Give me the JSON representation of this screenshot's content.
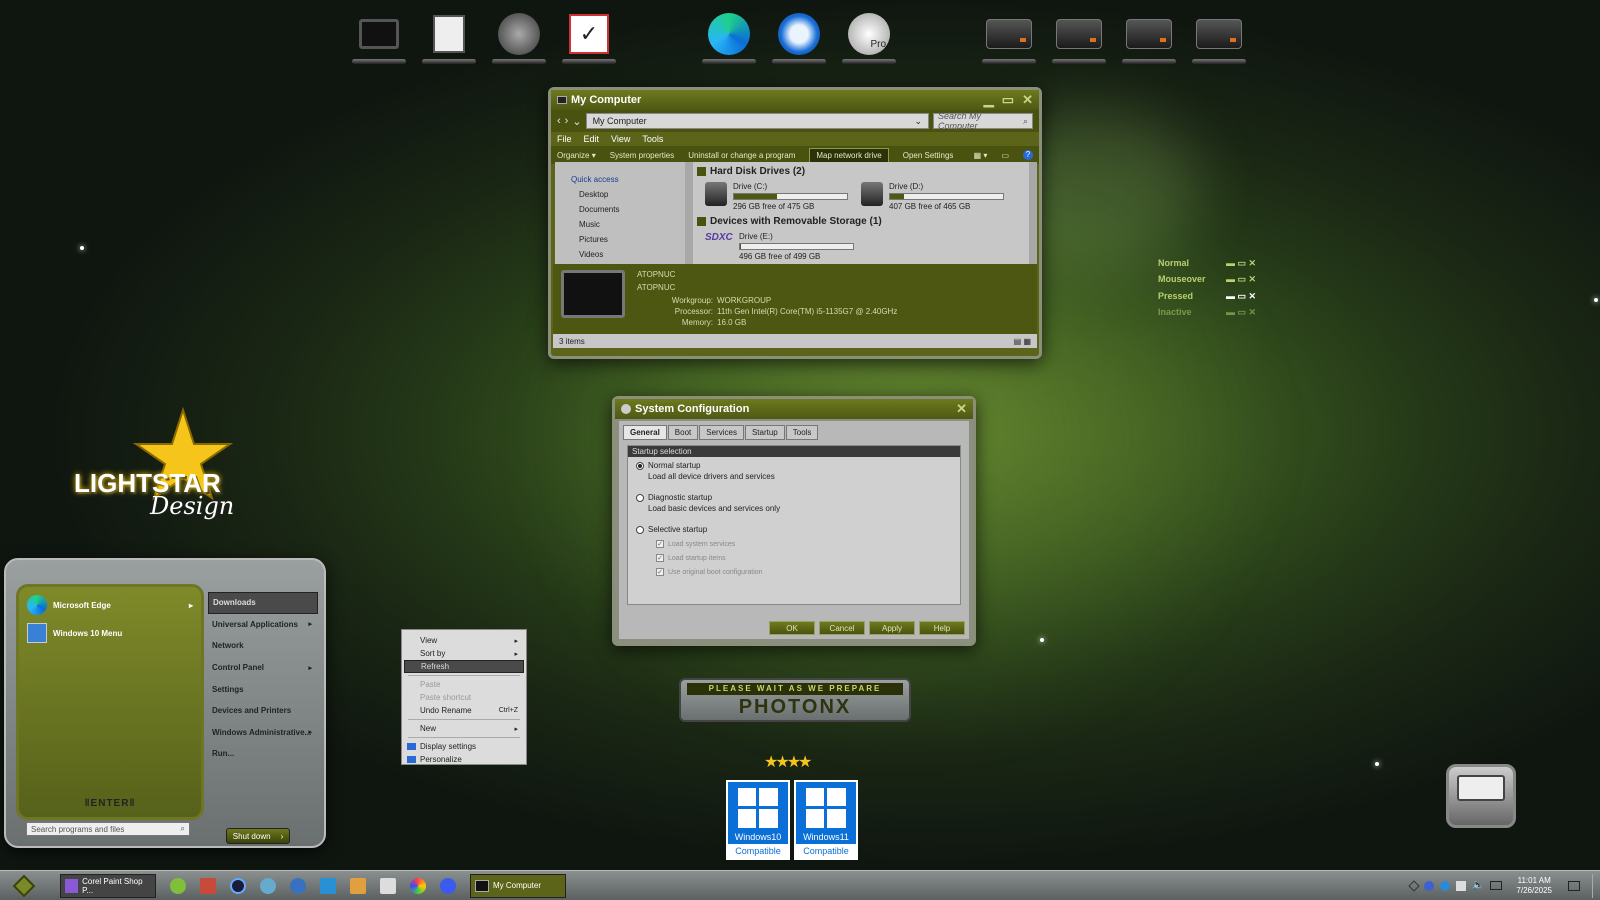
{
  "dock": {
    "left": [
      {
        "icon": "computer-icon"
      },
      {
        "icon": "documents-icon"
      },
      {
        "icon": "network-dish-icon"
      },
      {
        "icon": "checklist-icon"
      }
    ],
    "center": [
      {
        "icon": "edge-icon"
      },
      {
        "icon": "thunderbird-icon"
      },
      {
        "icon": "pro-icon",
        "label": "Pro"
      }
    ],
    "right": [
      {
        "icon": "drive-dvd-icon"
      },
      {
        "icon": "drive-icon"
      },
      {
        "icon": "drive-icon"
      },
      {
        "icon": "drive-icon"
      }
    ]
  },
  "mycomputer": {
    "title": "My Computer",
    "address": "My Computer",
    "search_placeholder": "Search My Computer",
    "menu": [
      "File",
      "Edit",
      "View",
      "Tools"
    ],
    "commands": [
      "Organize",
      "System properties",
      "Uninstall or change a program",
      "Map network drive",
      "Open Settings"
    ],
    "nav": [
      "Quick access",
      "Desktop",
      "Documents",
      "Music",
      "Pictures",
      "Videos"
    ],
    "section_hdd": "Hard Disk Drives (2)",
    "section_removable": "Devices with Removable Storage (1)",
    "drives": [
      {
        "name": "Drive (C:)",
        "free": "296 GB free of 475 GB",
        "used_fraction": 0.38
      },
      {
        "name": "Drive (D:)",
        "free": "407 GB free of 465 GB",
        "used_fraction": 0.12
      },
      {
        "name": "Drive (E:)",
        "free": "496 GB free of 499 GB",
        "used_fraction": 0.01
      }
    ],
    "sdxc_label": "SDXC",
    "pc_name": "ATOPNUC",
    "pc_name2": "ATOPNUC",
    "workgroup_label": "Workgroup:",
    "workgroup": "WORKGROUP",
    "processor_label": "Processor:",
    "processor": "11th Gen Intel(R) Core(TM) i5-1135G7 @ 2.40GHz",
    "memory_label": "Memory:",
    "memory": "16.0 GB",
    "status": "3 items"
  },
  "states": [
    {
      "label": "Normal"
    },
    {
      "label": "Mouseover"
    },
    {
      "label": "Pressed"
    },
    {
      "label": "Inactive"
    }
  ],
  "logo": {
    "line1": "LIGHTSTAR",
    "line2": "Design"
  },
  "sysconfig": {
    "title": "System Configuration",
    "tabs": [
      "General",
      "Boot",
      "Services",
      "Startup",
      "Tools"
    ],
    "group": "Startup selection",
    "normal": "Normal startup",
    "normal_desc": "Load all device drivers and services",
    "diagnostic": "Diagnostic startup",
    "diagnostic_desc": "Load basic devices and services only",
    "selective": "Selective startup",
    "checks": [
      "Load system services",
      "Load startup items",
      "Use original boot configuration"
    ],
    "buttons": [
      "OK",
      "Cancel",
      "Apply",
      "Help"
    ]
  },
  "context": {
    "items": [
      {
        "label": "View",
        "arrow": true
      },
      {
        "label": "Sort by",
        "arrow": true
      },
      {
        "label": "Refresh",
        "hl": true
      },
      {
        "sep": true
      },
      {
        "label": "Paste",
        "dis": true
      },
      {
        "label": "Paste shortcut",
        "dis": true
      },
      {
        "label": "Undo Rename",
        "shortcut": "Ctrl+Z"
      },
      {
        "sep": true
      },
      {
        "label": "New",
        "arrow": true
      },
      {
        "sep": true
      },
      {
        "label": "Display settings",
        "icon": true
      },
      {
        "label": "Personalize",
        "icon": true
      }
    ]
  },
  "banner": {
    "top": "PLEASE WAIT AS WE PREPARE",
    "main": "PHOTONX"
  },
  "badges": [
    {
      "os": "Windows10",
      "compat": "Compatible"
    },
    {
      "os": "Windows11",
      "compat": "Compatible"
    }
  ],
  "start": {
    "pinned": [
      "Microsoft Edge",
      "Windows 10 Menu"
    ],
    "right": [
      "Downloads",
      "Universal Applications",
      "Network",
      "Control Panel",
      "Settings",
      "Devices and Printers",
      "Windows Administrative...",
      "Run..."
    ],
    "enter": "ENTER",
    "search_placeholder": "Search programs and files",
    "shutdown": "Shut down"
  },
  "taskbar": {
    "app1": "Corel Paint Shop P...",
    "app2": "My Computer",
    "time": "11:01 AM",
    "date": "7/26/2025"
  }
}
